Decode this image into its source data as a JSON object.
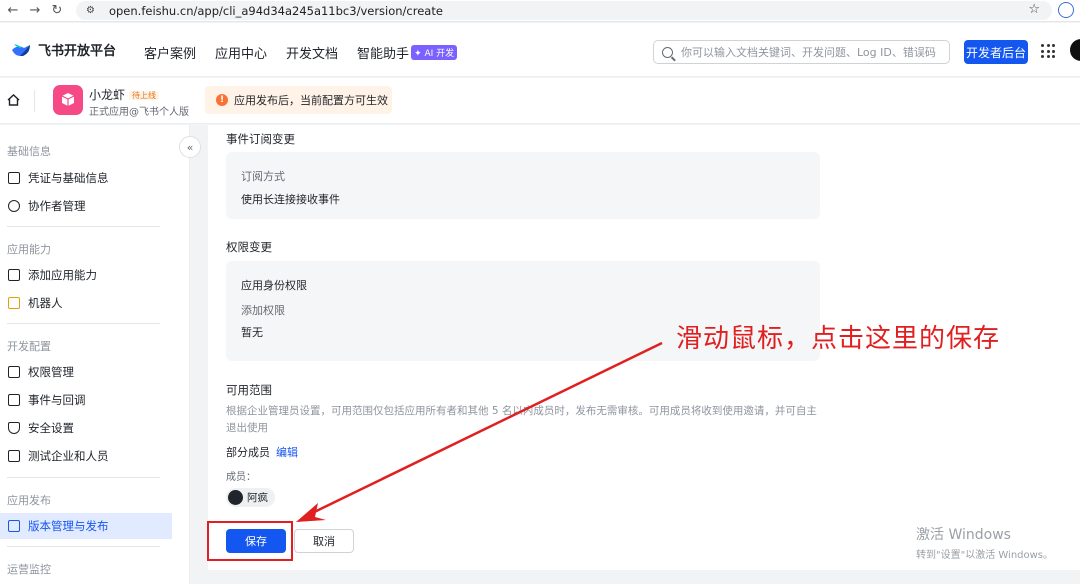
{
  "browser": {
    "url": "open.feishu.cn/app/cli_a94d34a245a11bc3/version/create"
  },
  "topbar": {
    "brand": "飞书开放平台",
    "nav": [
      "客户案例",
      "应用中心",
      "开发文档",
      "智能助手"
    ],
    "ai_badge": "✦ AI 开发",
    "search_placeholder": "你可以输入文档关键词、开发问题、Log ID、错误码",
    "dev_button": "开发者后台"
  },
  "app": {
    "name": "小龙虾",
    "tag": "待上线",
    "subtitle": "正式应用@飞书个人版",
    "notice": "应用发布后，当前配置方可生效"
  },
  "sidebar": {
    "sections": [
      {
        "title": "基础信息",
        "items": [
          "凭证与基础信息",
          "协作者管理"
        ]
      },
      {
        "title": "应用能力",
        "items": [
          "添加应用能力",
          "机器人"
        ]
      },
      {
        "title": "开发配置",
        "items": [
          "权限管理",
          "事件与回调",
          "安全设置",
          "测试企业和人员"
        ]
      },
      {
        "title": "应用发布",
        "items": [
          "版本管理与发布"
        ]
      },
      {
        "title": "运营监控",
        "items": []
      }
    ],
    "active_item": "版本管理与发布"
  },
  "main": {
    "event_change_title": "事件订阅变更",
    "subscribe_method_label": "订阅方式",
    "subscribe_method_value": "使用长连接接收事件",
    "permission_change_title": "权限变更",
    "app_identity_label": "应用身份权限",
    "add_permission_label": "添加权限",
    "add_permission_value": "暂无",
    "scope_title": "可用范围",
    "scope_desc": "根据企业管理员设置，可用范围仅包括应用所有者和其他 5 名以内成员时，发布无需审核。可用成员将收到使用邀请，并可自主退出使用",
    "scope_members": "部分成员",
    "edit_label": "编辑",
    "member_label": "成员：",
    "member_name": "阿疯",
    "save_label": "保存",
    "cancel_label": "取消"
  },
  "annotation": {
    "text": "滑动鼠标，点击这里的保存",
    "color": "#e02020"
  },
  "watermark": {
    "title": "激活 Windows",
    "subtitle": "转到\"设置\"以激活 Windows。"
  },
  "colors": {
    "primary": "#1456f0",
    "annotation": "#e02020",
    "notice_bg": "#fff3e8"
  }
}
